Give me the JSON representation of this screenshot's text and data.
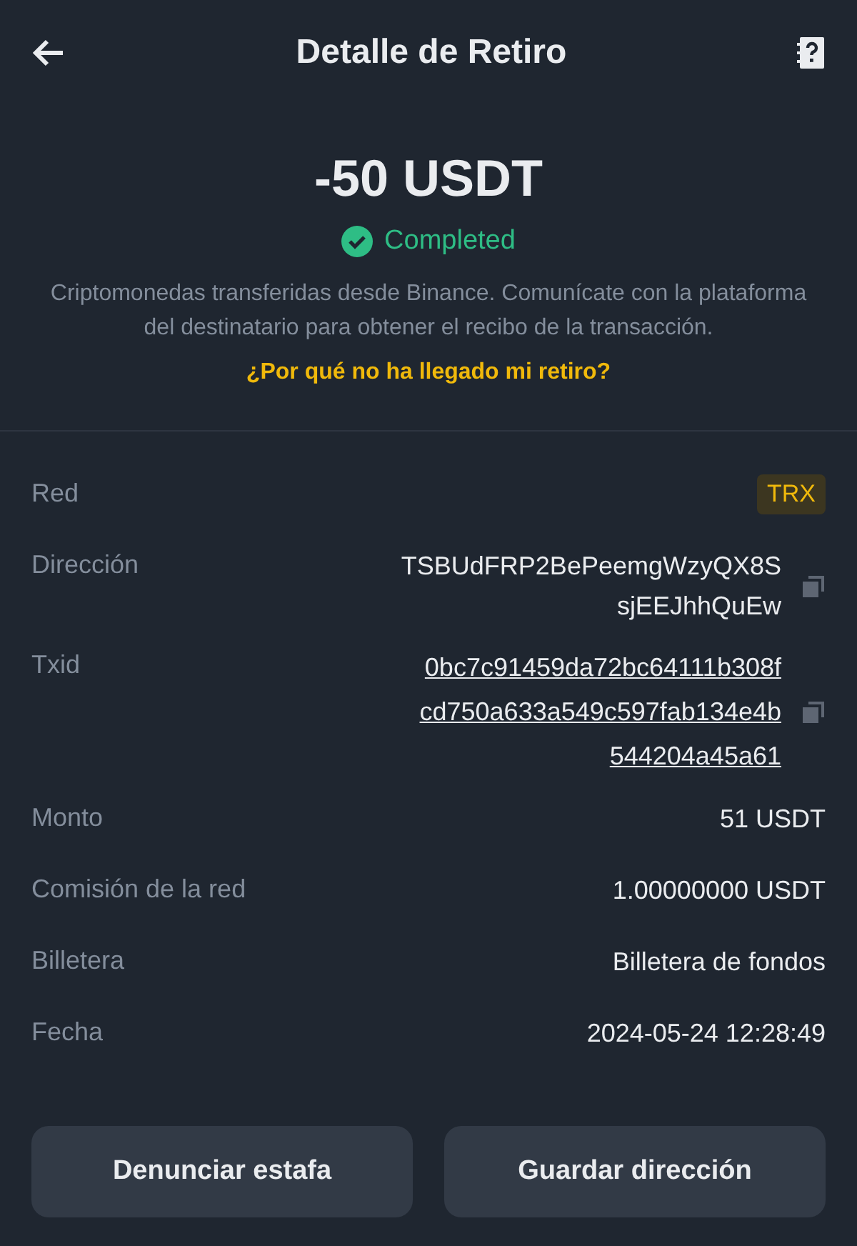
{
  "header": {
    "title": "Detalle de Retiro"
  },
  "amount": "-50 USDT",
  "status": {
    "label": "Completed",
    "kind": "completed"
  },
  "description": "Criptomonedas transferidas desde Binance. Comunícate con la plataforma del destinatario para obtener el recibo de la transacción.",
  "help_link": "¿Por qué no ha llegado mi retiro?",
  "details": [
    {
      "label": "Red",
      "kind": "badge",
      "lines": [
        "TRX"
      ]
    },
    {
      "label": "Dirección",
      "kind": "copy",
      "lines": [
        "TSBUdFRP2BePeemgWzyQX8S",
        "sjEEJhhQuEw"
      ]
    },
    {
      "label": "Txid",
      "kind": "link-copy",
      "lines": [
        "0bc7c91459da72bc64111b308f",
        "cd750a633a549c597fab134e4b",
        "544204a45a61"
      ]
    },
    {
      "label": "Monto",
      "kind": "plain",
      "lines": [
        "51 USDT"
      ]
    },
    {
      "label": "Comisión de la red",
      "kind": "plain",
      "lines": [
        "1.00000000 USDT"
      ]
    },
    {
      "label": "Billetera",
      "kind": "plain",
      "lines": [
        "Billetera de fondos"
      ]
    },
    {
      "label": "Fecha",
      "kind": "plain",
      "lines": [
        "2024-05-24 12:28:49"
      ]
    }
  ],
  "buttons": [
    "Denunciar estafa",
    "Guardar dirección"
  ]
}
